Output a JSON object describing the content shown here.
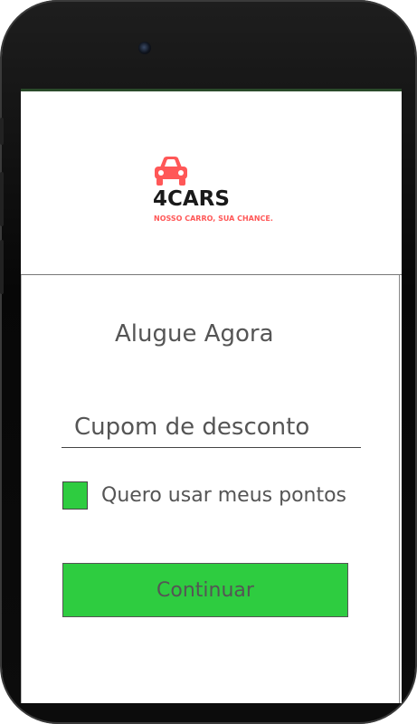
{
  "app": {
    "brand": "4CARS",
    "tagline": "NOSSO CARRO, SUA CHANCE.",
    "accent_color": "#2ecc40",
    "brand_color": "#ff5757",
    "logo_icon": "car-icon"
  },
  "main": {
    "title": "Alugue Agora",
    "coupon": {
      "placeholder": "Cupom de desconto",
      "value": ""
    },
    "points_checkbox": {
      "label": "Quero usar meus pontos",
      "checked": true
    },
    "continue_label": "Continuar"
  }
}
